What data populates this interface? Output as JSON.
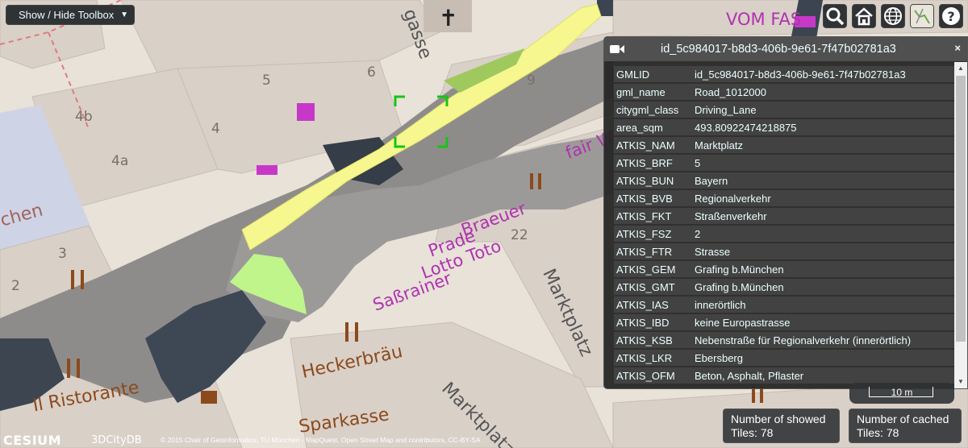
{
  "toolbox": {
    "label": "Show / Hide Toolbox",
    "caret": "▼"
  },
  "toolbar": [
    {
      "name": "search-button",
      "icon": "search-icon"
    },
    {
      "name": "home-button",
      "icon": "home-icon"
    },
    {
      "name": "globe-button",
      "icon": "globe-icon"
    },
    {
      "name": "imagery-button",
      "icon": "layers-icon"
    },
    {
      "name": "help-button",
      "icon": "help-icon"
    }
  ],
  "info_panel": {
    "title": "id_5c984017-b8d3-406b-9e61-7f47b02781a3",
    "close": "×",
    "rows": [
      {
        "key": "GMLID",
        "value": "id_5c984017-b8d3-406b-9e61-7f47b02781a3"
      },
      {
        "key": "gml_name",
        "value": "Road_1012000"
      },
      {
        "key": "citygml_class",
        "value": "Driving_Lane"
      },
      {
        "key": "area_sqm",
        "value": "493.80922474218875"
      },
      {
        "key": "ATKIS_NAM",
        "value": "Marktplatz"
      },
      {
        "key": "ATKIS_BRF",
        "value": "5"
      },
      {
        "key": "ATKIS_BUN",
        "value": "Bayern"
      },
      {
        "key": "ATKIS_BVB",
        "value": "Regionalverkehr"
      },
      {
        "key": "ATKIS_FKT",
        "value": "Straßenverkehr"
      },
      {
        "key": "ATKIS_FSZ",
        "value": "2"
      },
      {
        "key": "ATKIS_FTR",
        "value": "Strasse"
      },
      {
        "key": "ATKIS_GEM",
        "value": "Grafing b.München"
      },
      {
        "key": "ATKIS_GMT",
        "value": "Grafing b.München"
      },
      {
        "key": "ATKIS_IAS",
        "value": "innerörtlich"
      },
      {
        "key": "ATKIS_IBD",
        "value": "keine Europastrasse"
      },
      {
        "key": "ATKIS_KSB",
        "value": "Nebenstraße für Regionalverkehr (innerörtlich)"
      },
      {
        "key": "ATKIS_LKR",
        "value": "Ebersberg"
      },
      {
        "key": "ATKIS_OFM",
        "value": "Beton, Asphalt, Pflaster"
      }
    ]
  },
  "scale": {
    "label": "10 m"
  },
  "tiles": {
    "showed": "Number of showed Tiles: 78",
    "cached": "Number of cached Tiles: 78"
  },
  "credits": {
    "cesium": "CESIUM",
    "citydb": "3DCityDB",
    "text": "© 2015 Chair of Geoinformatics, TU München - MapQuest, Open Street Map and contributors, CC-BY-SA"
  },
  "map_labels": {
    "house_numbers": [
      "5",
      "6",
      "9",
      "4b",
      "4",
      "4a",
      "3",
      "2",
      "22"
    ],
    "streets": [
      "Marktplatz",
      "Marktplatz",
      "Heckerbräu",
      "Il Ristorante",
      "Sparkasse",
      "Saßrainer",
      "Lotto Toto",
      "Prade",
      "Braeuer",
      "fair W",
      "chen",
      "VOM FAS",
      "gasse"
    ]
  },
  "colors": {
    "panel_bg": "#262626",
    "row_bg": "#424242",
    "selection": "#00ff00",
    "highlight_road": "#f6f78f",
    "highlight_green": "#bff58a"
  }
}
